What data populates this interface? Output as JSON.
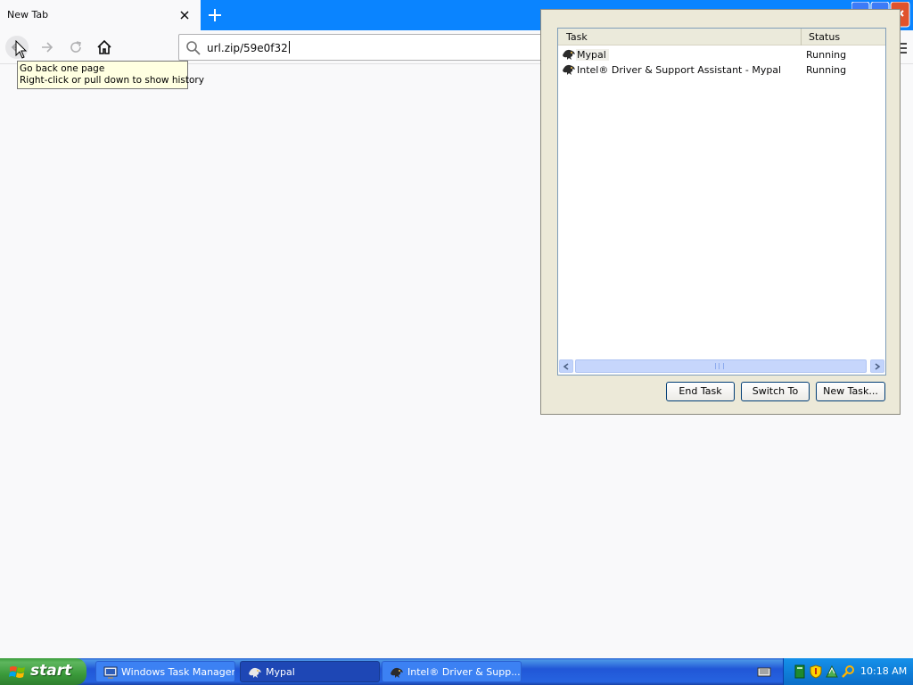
{
  "browser": {
    "tab": {
      "title": "New Tab"
    },
    "url": {
      "value": "url.zip/59e0f32"
    },
    "tooltip": {
      "line1": "Go back one page",
      "line2": "Right-click or pull down to show history"
    },
    "accent": "#0a84ff"
  },
  "task_manager": {
    "columns": {
      "task": "Task",
      "status": "Status"
    },
    "rows": [
      {
        "task": "Mypal",
        "status": "Running"
      },
      {
        "task": "Intel® Driver & Support Assistant - Mypal",
        "status": "Running"
      }
    ],
    "buttons": {
      "end_task": "End Task",
      "switch_to": "Switch To",
      "new_task": "New Task..."
    }
  },
  "taskbar": {
    "start_label": "start",
    "buttons": [
      {
        "label": "Windows Task Manager",
        "icon": "task-manager-icon"
      },
      {
        "label": "Mypal",
        "icon": "mypal-icon",
        "active": true
      },
      {
        "label": "Intel® Driver & Supp...",
        "icon": "mypal-icon"
      }
    ],
    "clock": "10:18 AM"
  }
}
